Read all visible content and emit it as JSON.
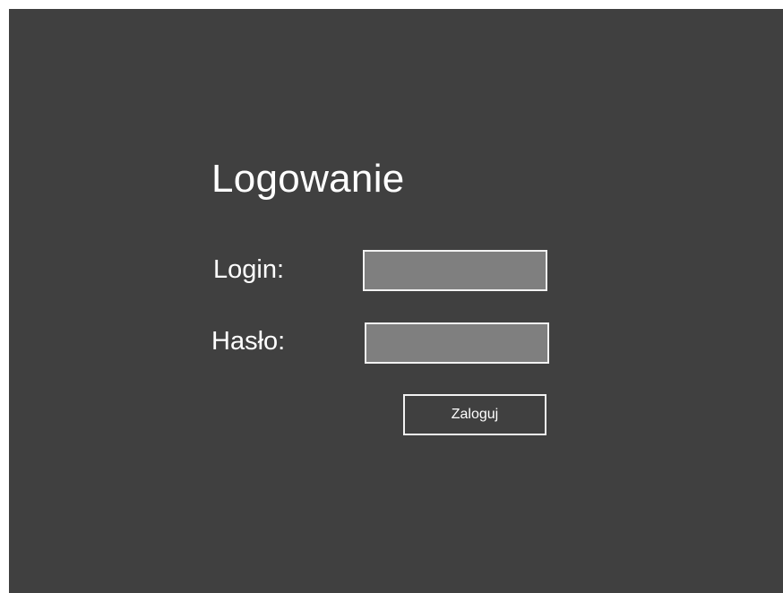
{
  "login_panel": {
    "title": "Logowanie",
    "login_label": "Login:",
    "login_value": "",
    "password_label": "Hasło:",
    "password_value": "",
    "submit_label": "Zaloguj"
  },
  "colors": {
    "background": "#404040",
    "field_fill": "#7f7f7f",
    "border": "#f2f2f2",
    "text": "#ffffff"
  }
}
